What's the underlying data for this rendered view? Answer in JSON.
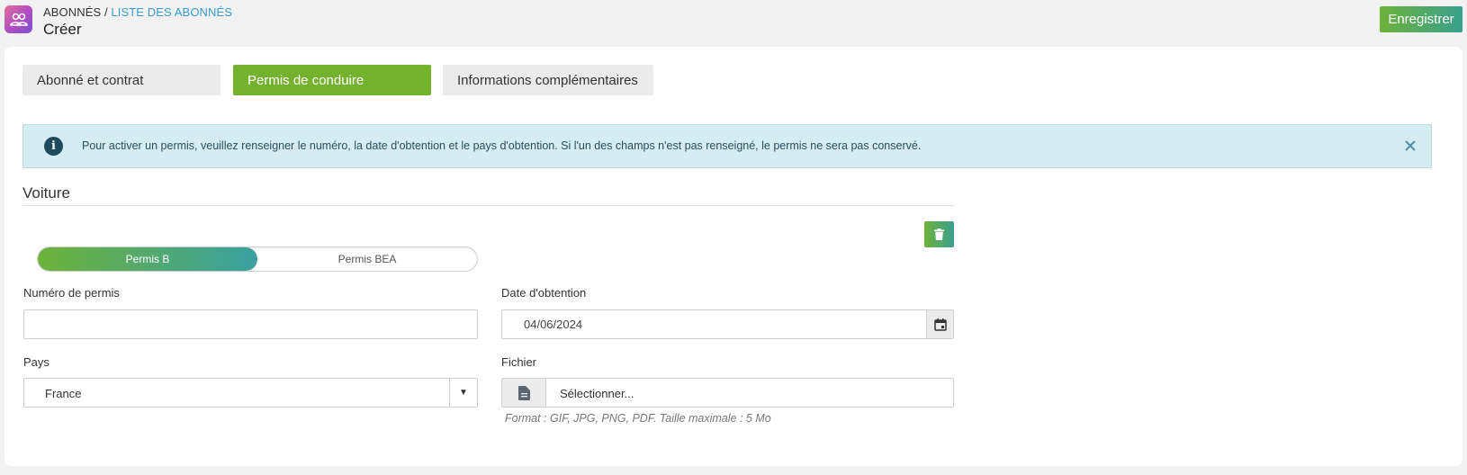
{
  "header": {
    "breadcrumb_root": "ABONNÉS",
    "breadcrumb_sep": " / ",
    "breadcrumb_link": "LISTE DES ABONNÉS",
    "title": "Créer",
    "save_label": "Enregistrer"
  },
  "tabs": [
    {
      "label": "Abonné et contrat",
      "active": false
    },
    {
      "label": "Permis de conduire",
      "active": true
    },
    {
      "label": "Informations complémentaires",
      "active": false
    }
  ],
  "alert": {
    "icon": "info-icon",
    "text": "Pour activer un permis, veuillez renseigner le numéro, la date d'obtention et le pays d'obtention. Si l'un des champs n'est pas renseigné, le permis ne sera pas conservé."
  },
  "section": {
    "title": "Voiture",
    "license_types": [
      "Permis B",
      "Permis BEA"
    ],
    "selected_type": "Permis B"
  },
  "form": {
    "license_number_label": "Numéro de permis",
    "license_number_value": "",
    "obtain_date_label": "Date d'obtention",
    "obtain_date_value": "04/06/2024",
    "country_label": "Pays",
    "country_value": "France",
    "file_label": "Fichier",
    "file_button_text": "Sélectionner...",
    "file_hint": "Format : GIF, JPG, PNG, PDF. Taille maximale : 5 Mo"
  },
  "colors": {
    "accent_green": "#74b22e",
    "accent_teal": "#3aa08f",
    "link_blue": "#3a9ad1",
    "alert_bg": "#d4ecf2"
  }
}
